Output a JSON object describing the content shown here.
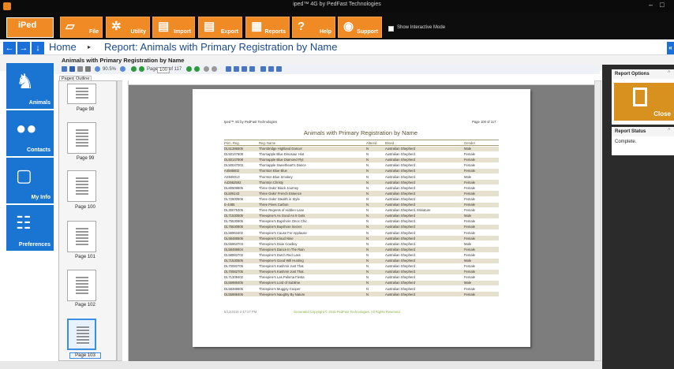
{
  "window": {
    "title": "iped™ 4G by PedFast Technologies",
    "minimize": "–",
    "maximize": "□"
  },
  "ribbon": {
    "logo": "iPed",
    "buttons": [
      {
        "label": "File",
        "icon": "folder-icon"
      },
      {
        "label": "Utility",
        "icon": "gear-icon"
      },
      {
        "label": "Import",
        "icon": "import-icon"
      },
      {
        "label": "Export",
        "icon": "export-icon"
      },
      {
        "label": "Reports",
        "icon": "printer-icon"
      },
      {
        "label": "Help",
        "icon": "question-icon"
      },
      {
        "label": "Support",
        "icon": "lifebuoy-icon"
      }
    ],
    "interactive_mode_label": "Show Interactive Mode"
  },
  "nav": {
    "home": "Home",
    "breadcrumb": "Report: Animals with Primary Registration by Name"
  },
  "subtitle": "Animals with Primary Registration by Name",
  "sidebar": [
    {
      "label": "Animals",
      "icon": "dog-icon"
    },
    {
      "label": "Contacts",
      "icon": "people-icon"
    },
    {
      "label": "My Info",
      "icon": "person-icon"
    },
    {
      "label": "Preferences",
      "icon": "preferences-icon"
    }
  ],
  "viewer": {
    "zoom": "90.5%",
    "page_label": "Page",
    "page_value": "100",
    "page_of": "of 117",
    "tabs": [
      "Pages",
      "Outline"
    ],
    "thumbnails": [
      "Page 98",
      "Page 99",
      "Page 100",
      "Page 101",
      "Page 102",
      "Page 103"
    ]
  },
  "report": {
    "header_left": "Iped™ 4G by PedFast Technologies",
    "header_right": "Page 100 of 117",
    "title": "Animals with Primary Registration by Name",
    "columns": [
      "Prim. Reg.",
      "Reg. Name",
      "Altered",
      "Breed",
      "Gender"
    ],
    "rows": [
      [
        "DL51386505",
        "Thornbridge Highland Dancer",
        "N",
        "Australian Shepherd",
        "Male"
      ],
      [
        "DL50147808",
        "Thornapple Blue Dinosaur Hiot",
        "N",
        "Australian Shepherd",
        "Female"
      ],
      [
        "DL50147808",
        "Thornapple Blue Diamond Flyt",
        "N",
        "Australian Shepherd",
        "Female"
      ],
      [
        "DL50047003",
        "Thornapple Sweetheart's Dance",
        "N",
        "Australian Shepherd",
        "Female"
      ],
      [
        "A4566602",
        "Thornton Blue Blue",
        "N",
        "Australian Shepherd",
        "Female"
      ],
      [
        "AS946013",
        "Thornton Blue Smokey",
        "N",
        "Australian Shepherd",
        "Male"
      ],
      [
        "A42562592",
        "Thornton Christy",
        "N",
        "Australian Shepherd",
        "Female"
      ],
      [
        "DL80509805",
        "Three Oaks' Black Journey",
        "N",
        "Australian Shepherd",
        "Female"
      ],
      [
        "DL509143",
        "Three Oaks' French Essence",
        "N",
        "Australian Shepherd",
        "Female"
      ],
      [
        "DL72800506",
        "Three Oaks' Stealth in Style",
        "N",
        "Australian Shepherd",
        "Female"
      ],
      [
        "E-4485",
        "Three Pines Carbon",
        "N",
        "Australian Shepherd",
        "Female"
      ],
      [
        "DL30075305",
        "Three Regents of Hidden Lane",
        "N",
        "Australian Shepherd, Miniature",
        "Female"
      ],
      [
        "DL71530505",
        "Threepine's As Good As It Gets",
        "N",
        "Australian Shepherd",
        "Male"
      ],
      [
        "DL75530805",
        "Threepine's Bayshore Once Chic",
        "N",
        "Australian Shepherd",
        "Female"
      ],
      [
        "DL75530805",
        "Threepine's Bayshore Secret",
        "N",
        "Australian Shepherd",
        "Female"
      ],
      [
        "DL56963402",
        "Threepine's Cause For Applause",
        "N",
        "Australian Shepherd",
        "Female"
      ],
      [
        "DL58488506",
        "Threepine's Cloud Nine",
        "N",
        "Australian Shepherd",
        "Female"
      ],
      [
        "DL55963703",
        "Threepine's Dixie Cowboy",
        "N",
        "Australian Shepherd",
        "Male"
      ],
      [
        "DL58488604",
        "Threepine's Dance In The Rain",
        "N",
        "Australian Shepherd",
        "Female"
      ],
      [
        "DL58983702",
        "Threepine's Dutch Red Lass",
        "N",
        "Australian Shepherd",
        "Female"
      ],
      [
        "DL71530505",
        "Threepine's Good Will Hunting",
        "N",
        "Australian Shepherd",
        "Male"
      ],
      [
        "DL70082705",
        "Threepine's Kashmir Just That",
        "N",
        "Australian Shepherd",
        "Female"
      ],
      [
        "DL70082705",
        "Threepine's Kashmir Just That",
        "N",
        "Australian Shepherd",
        "Female"
      ],
      [
        "DL71309402",
        "Threepine's Las Paloma Fiesta",
        "N",
        "Australian Shepherd",
        "Female"
      ],
      [
        "DL55988405",
        "Threepine's Lord of Sublime",
        "N",
        "Australian Shepherd",
        "Male"
      ],
      [
        "DL58488605",
        "Threepine's Muggsy Cooper",
        "N",
        "Australian Shepherd",
        "Female"
      ],
      [
        "DL55988405",
        "Threepine's Naughty By Nature",
        "N",
        "Australian Shepherd",
        "Female"
      ]
    ],
    "footer_left": "5/12/2018 2:47:27 PM",
    "footer_center": "Generated Copyright © 2018 PedFast Technologies. All Rights Reserved"
  },
  "right": {
    "options_header": "Report Options",
    "close": "Close",
    "status_header": "Report Status",
    "status": "Complete."
  }
}
